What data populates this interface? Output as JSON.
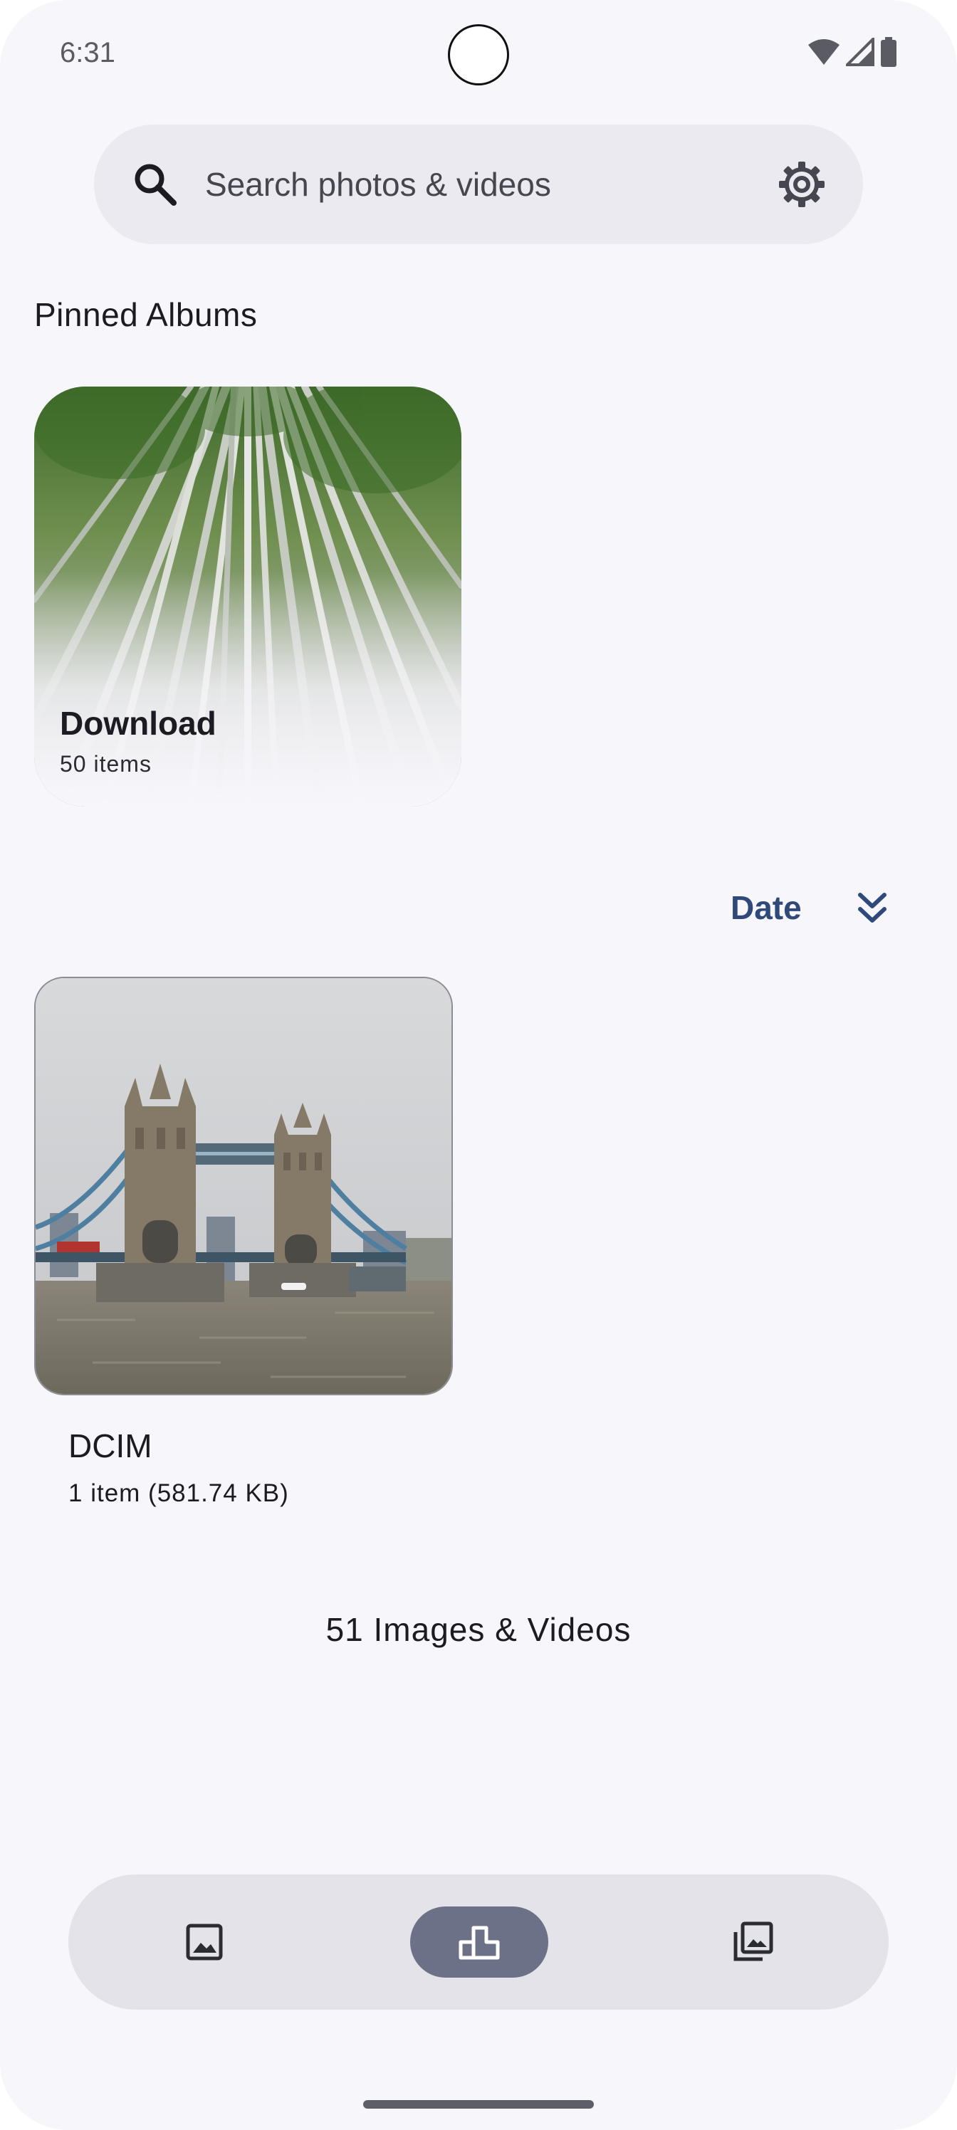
{
  "status_bar": {
    "time": "6:31",
    "icons": [
      "wifi-icon",
      "cell-signal-icon",
      "battery-icon"
    ]
  },
  "search": {
    "placeholder": "Search photos & videos",
    "leading_icon": "search-icon",
    "trailing_icon": "gear-icon"
  },
  "pinned": {
    "title": "Pinned Albums",
    "albums": [
      {
        "name": "Download",
        "count": "50 items"
      }
    ]
  },
  "sort": {
    "label": "Date",
    "order_icon": "double-chevron-down-icon"
  },
  "albums": [
    {
      "name": "DCIM",
      "meta": "1 item (581.74 KB)"
    }
  ],
  "summary": "51 Images & Videos",
  "bottom_nav": {
    "items": [
      {
        "icon": "image-icon",
        "selected": false
      },
      {
        "icon": "albums-icon",
        "selected": true
      },
      {
        "icon": "library-icon",
        "selected": false
      }
    ]
  },
  "colors": {
    "background": "#f7f6fb",
    "search_bar": "#ebeaf0",
    "accent": "#2f4a7a",
    "nav_bar": "#e4e3ea",
    "nav_active": "#6c7187"
  }
}
